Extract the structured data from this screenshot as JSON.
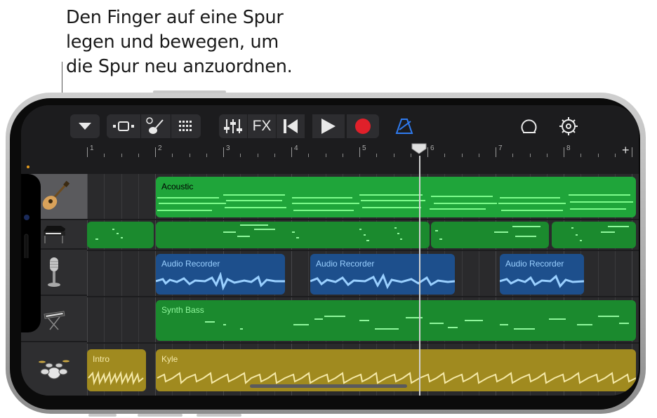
{
  "caption": {
    "line1": "Den Finger auf eine Spur",
    "line2": "legen und bewegen, um",
    "line3": "die Spur neu anzuordnen."
  },
  "toolbar": {
    "fx_label": "FX",
    "items": [
      "menu-dropdown",
      "tracks-view",
      "smart-controls",
      "instrument-grid",
      "mixer",
      "fx",
      "rewind",
      "play",
      "record",
      "metronome",
      "loop-browser",
      "settings"
    ]
  },
  "ruler": {
    "bars": [
      "1",
      "2",
      "3",
      "4",
      "5",
      "6",
      "7",
      "8"
    ]
  },
  "tracks": [
    {
      "name": "acoustic-guitar",
      "regions": [
        {
          "label": "Acoustic"
        }
      ]
    },
    {
      "name": "piano",
      "regions": []
    },
    {
      "name": "microphone",
      "regions": [
        {
          "label": "Audio Recorder"
        },
        {
          "label": "Audio Recorder"
        },
        {
          "label": "Audio Recorder"
        }
      ]
    },
    {
      "name": "keyboard-synth",
      "regions": [
        {
          "label": "Synth Bass"
        }
      ]
    },
    {
      "name": "drums",
      "regions": [
        {
          "label": "Intro"
        },
        {
          "label": "Kyle"
        }
      ]
    }
  ],
  "colors": {
    "green_region": "#1b8a2e",
    "blue_region": "#1d4f8c",
    "gold_region": "#a08a1f",
    "record": "#e0202a",
    "metronome": "#2f7bf0"
  }
}
